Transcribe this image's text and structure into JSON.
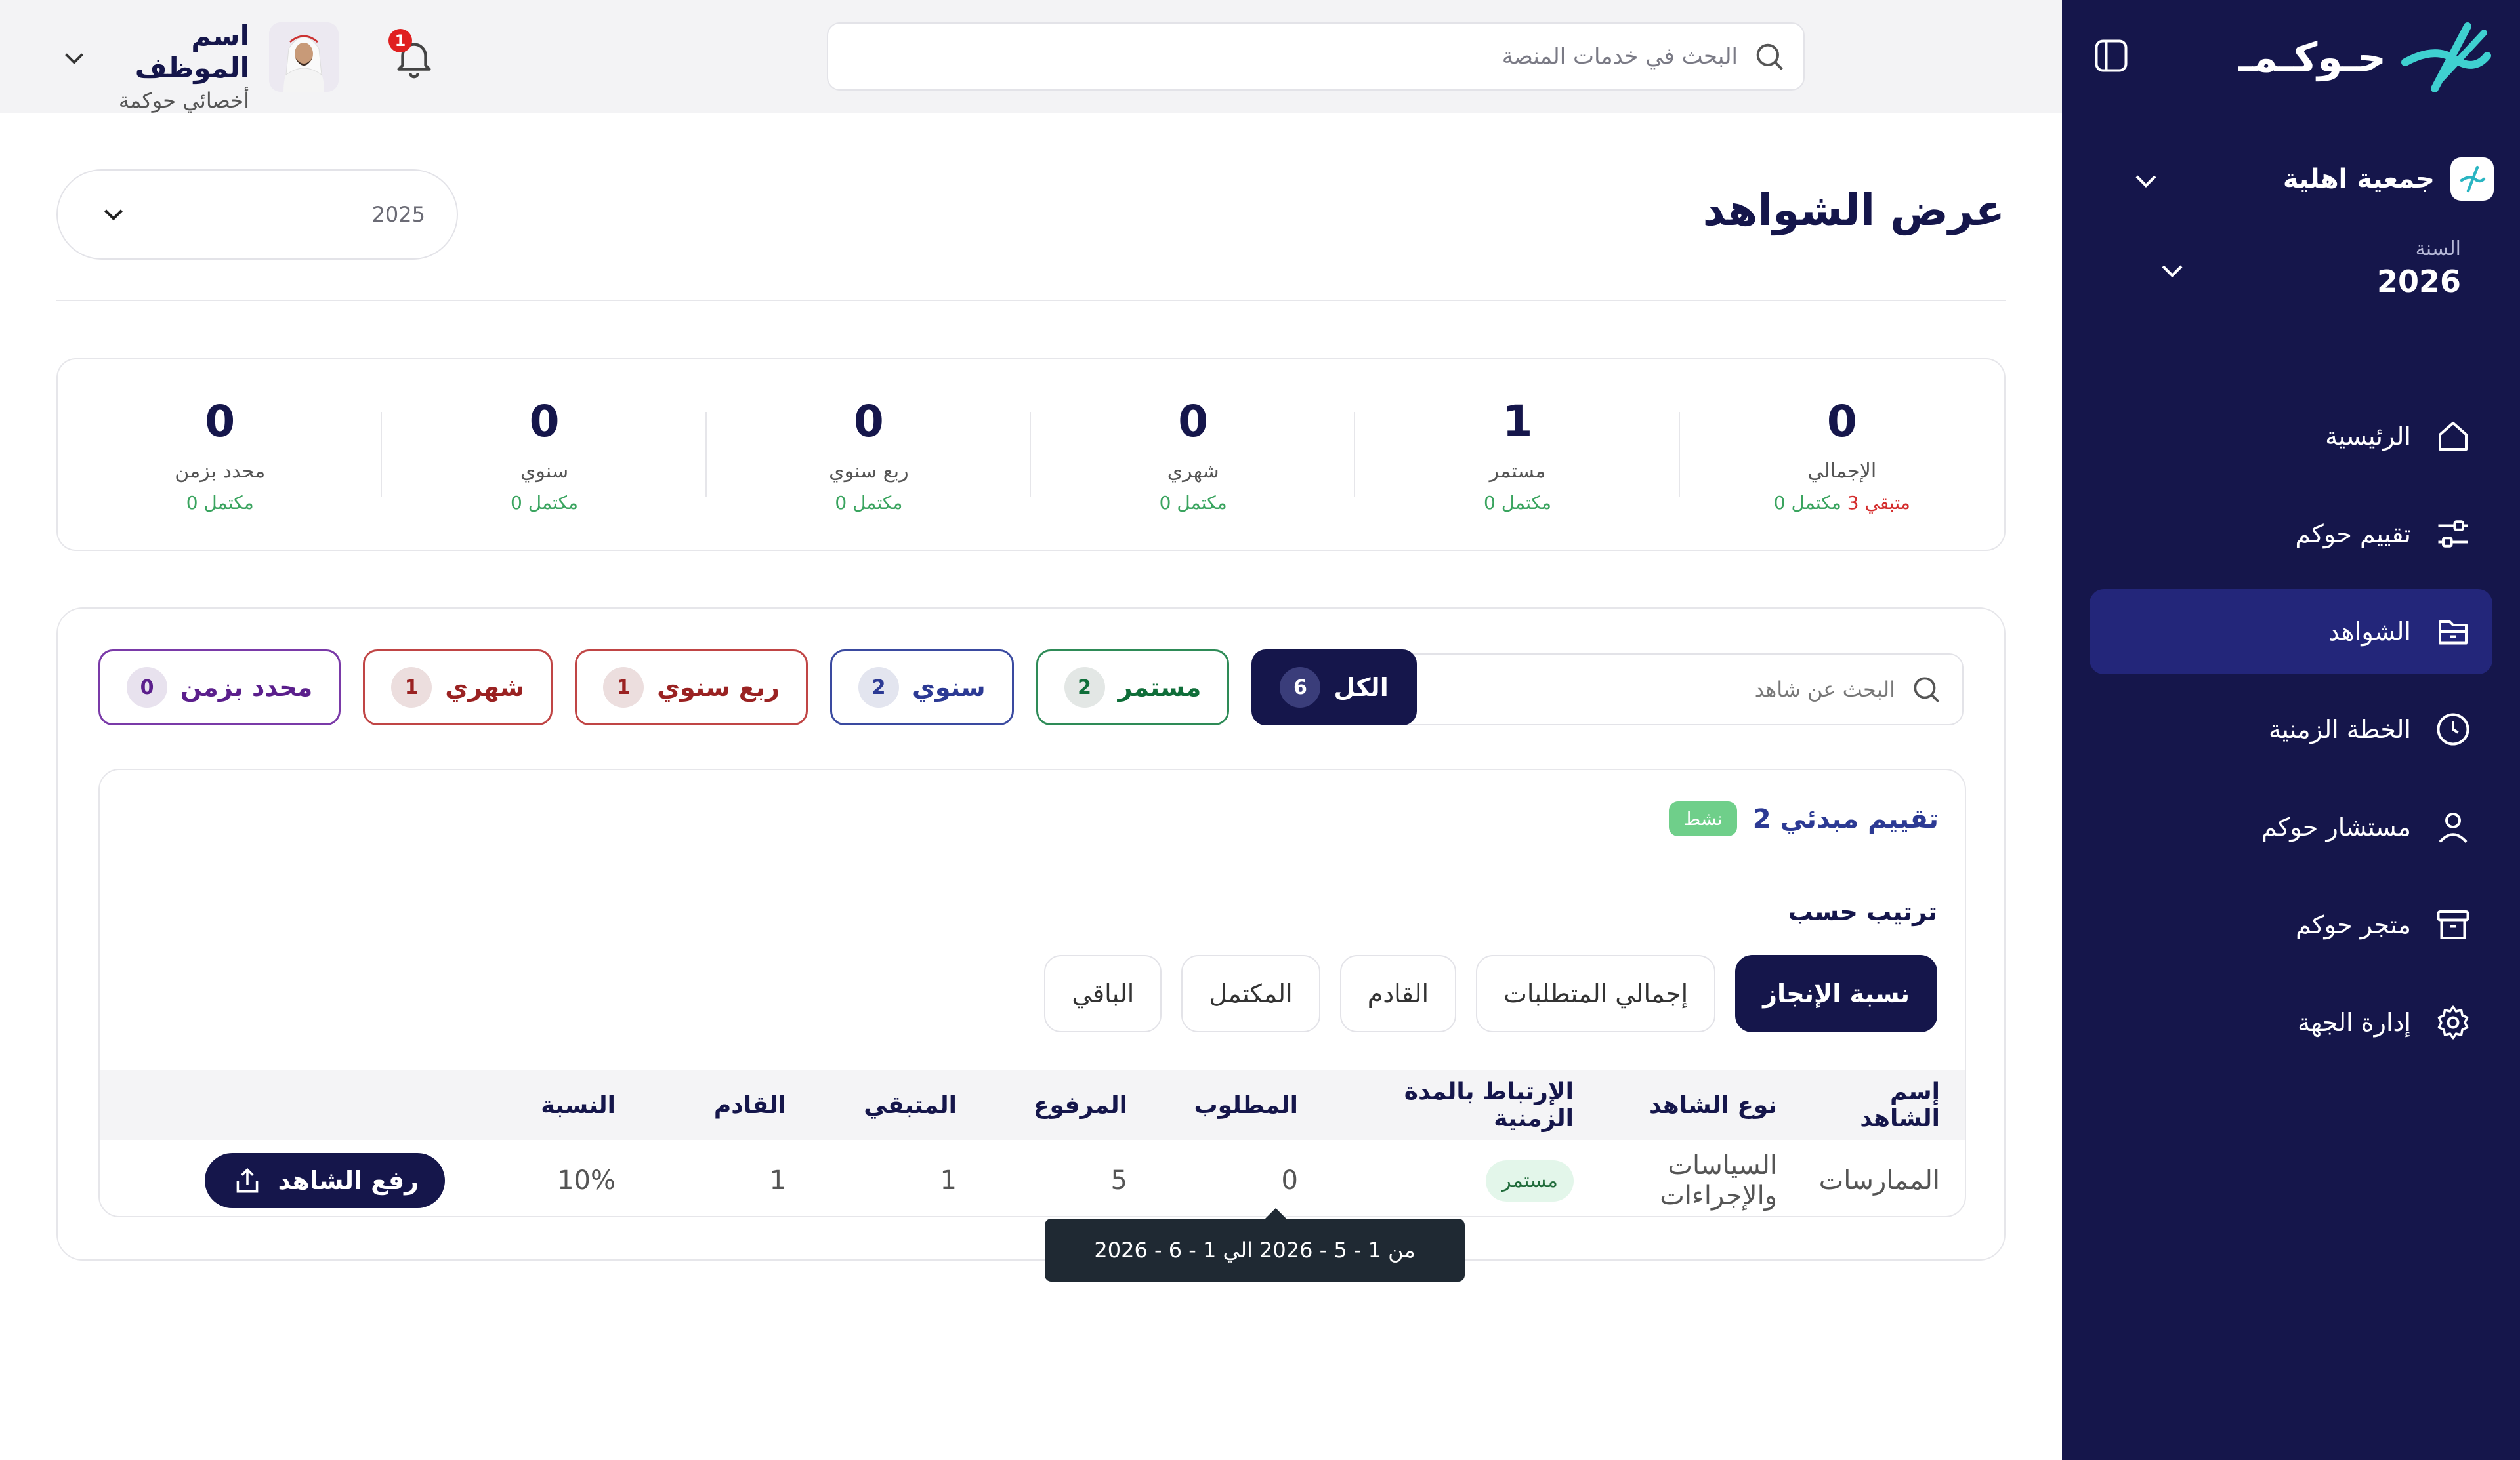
{
  "app": {
    "name": "حـوكـمـ"
  },
  "sidebar": {
    "org_name": "جمعية اهلية",
    "year_label": "السنة",
    "year_value": "2026",
    "items": [
      {
        "label": "الرئيسية",
        "icon": "home-icon"
      },
      {
        "label": "تقييم حوكم",
        "icon": "sliders-icon"
      },
      {
        "label": "الشواهد",
        "icon": "folder-icon",
        "active": true
      },
      {
        "label": "الخطة الزمنية",
        "icon": "clock-icon"
      },
      {
        "label": "مستشار حوكم",
        "icon": "user-icon"
      },
      {
        "label": "متجر حوكم",
        "icon": "archive-icon"
      },
      {
        "label": "إدارة الجهة",
        "icon": "gear-icon"
      }
    ]
  },
  "topbar": {
    "search_placeholder": "البحث في خدمات المنصة",
    "notifications_count": "1",
    "user_name": "اسم الموظف",
    "user_role": "أخصائي حوكمة"
  },
  "main": {
    "title": "عرض الشواهد",
    "year_select": "2025"
  },
  "stats": [
    {
      "value": "0",
      "label": "الإجمالي",
      "remaining": "متبقي 3",
      "completed": "مكتمل 0"
    },
    {
      "value": "1",
      "label": "مستمر",
      "completed": "مكتمل 0"
    },
    {
      "value": "0",
      "label": "شهري",
      "completed": "مكتمل 0"
    },
    {
      "value": "0",
      "label": "ربع سنوي",
      "completed": "مكتمل 0"
    },
    {
      "value": "0",
      "label": "سنوي",
      "completed": "مكتمل 0"
    },
    {
      "value": "0",
      "label": "محدد بزمن",
      "completed": "مكتمل 0"
    }
  ],
  "filters": {
    "search_placeholder": "البحث عن شاهد",
    "chips": [
      {
        "label": "الكل",
        "count": "6"
      },
      {
        "label": "مستمر",
        "count": "2"
      },
      {
        "label": "سنوي",
        "count": "2"
      },
      {
        "label": "ربع سنوي",
        "count": "1"
      },
      {
        "label": "شهري",
        "count": "1"
      },
      {
        "label": "محدد بزمن",
        "count": "0"
      }
    ]
  },
  "card": {
    "title": "تقييم مبدئي 2",
    "status": "نشط",
    "sort_label": "ترتيب حسب",
    "sort_options": [
      "نسبة الإنجاز",
      "إجمالي المتطلبات",
      "القادم",
      "المكتمل",
      "الباقي"
    ]
  },
  "table": {
    "headers": [
      "إسم الشاهد",
      "نوع الشاهد",
      "الإرتباط بالمدة الزمنية",
      "المطلوب",
      "المرفوع",
      "المتبقي",
      "القادم",
      "النسبة",
      ""
    ],
    "rows": [
      {
        "name": "الممارسات",
        "type": "السياسات والإجراءات",
        "link": "مستمر",
        "required": "0",
        "uploaded": "5",
        "remaining": "1",
        "upcoming": "1",
        "percent": "10%",
        "action": "رفع الشاهد"
      }
    ]
  },
  "tooltip": {
    "text": "من 1 - 5 - 2026 الي 1 - 6 - 2026"
  }
}
